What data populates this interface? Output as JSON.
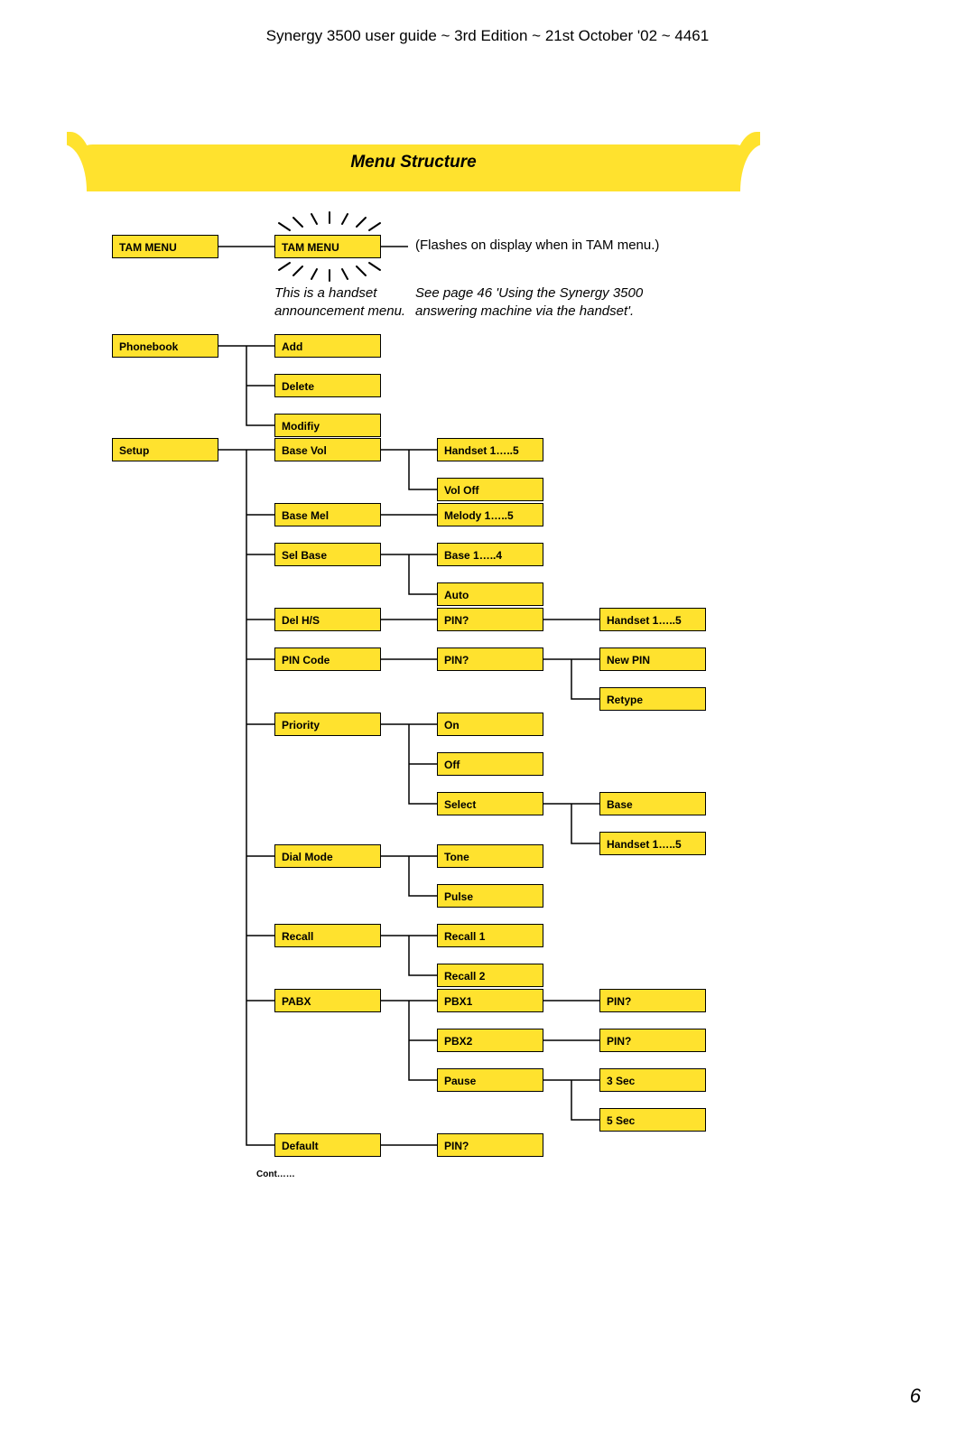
{
  "header": "Synergy 3500 user guide ~ 3rd Edition ~ 21st October '02 ~ 4461",
  "banner_title": "Menu Structure",
  "page_number": "6",
  "cont": "Cont……",
  "notes": {
    "flash": "(Flashes on display when in TAM menu.)",
    "handset": "This is a handset announcement menu.",
    "seepage": "See page 46 'Using the Synergy 3500 answering machine via the handset'."
  },
  "boxes": {
    "tam1": "TAM MENU",
    "tam2": "TAM MENU",
    "phonebook": "Phonebook",
    "add": "Add",
    "delete": "Delete",
    "modify": "Modifiy",
    "setup": "Setup",
    "basevol": "Base Vol",
    "handset15a": "Handset 1…..5",
    "voloff": "Vol Off",
    "basemel": "Base Mel",
    "melody": "Melody 1…..5",
    "selbase": "Sel Base",
    "base14": "Base 1…..4",
    "auto": "Auto",
    "delhs": "Del H/S",
    "pin1": "PIN?",
    "handset15b": "Handset 1…..5",
    "pincode": "PIN Code",
    "pin2": "PIN?",
    "newpin": "New PIN",
    "retype": "Retype",
    "priority": "Priority",
    "on": "On",
    "off": "Off",
    "select": "Select",
    "base": "Base",
    "handset15c": "Handset 1…..5",
    "dialmode": "Dial Mode",
    "tone": "Tone",
    "pulse": "Pulse",
    "recall": "Recall",
    "recall1": "Recall 1",
    "recall2": "Recall 2",
    "pabx": "PABX",
    "pbx1": "PBX1",
    "pin3": "PIN?",
    "pbx2": "PBX2",
    "pin4": "PIN?",
    "pause": "Pause",
    "sec3": "3 Sec",
    "sec5": "5 Sec",
    "default": "Default",
    "pin5": "PIN?"
  }
}
